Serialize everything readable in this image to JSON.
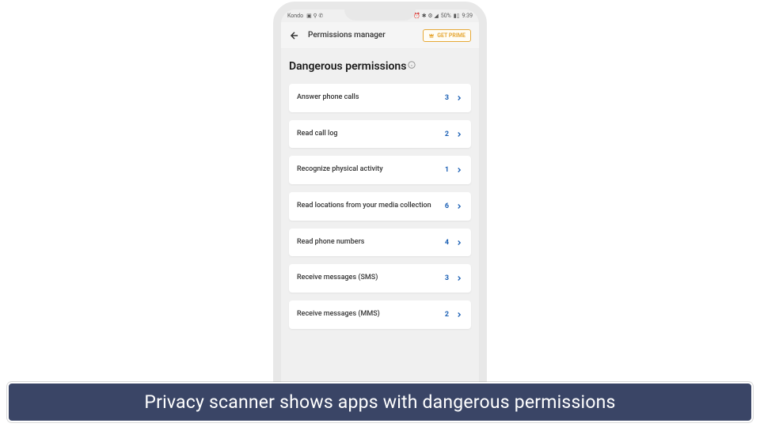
{
  "status_bar": {
    "carrier": "Kondo",
    "battery": "50%",
    "time": "9:39"
  },
  "header": {
    "title": "Permissions manager",
    "prime_label": "GET PRIME"
  },
  "section": {
    "title": "Dangerous permissions"
  },
  "permissions": [
    {
      "label": "Answer phone calls",
      "count": "3"
    },
    {
      "label": "Read call log",
      "count": "2"
    },
    {
      "label": "Recognize physical activity",
      "count": "1"
    },
    {
      "label": "Read locations from your media collection",
      "count": "6"
    },
    {
      "label": "Read phone numbers",
      "count": "4"
    },
    {
      "label": "Receive messages (SMS)",
      "count": "3"
    },
    {
      "label": "Receive messages (MMS)",
      "count": "2"
    }
  ],
  "caption": "Privacy scanner shows apps with dangerous permissions"
}
